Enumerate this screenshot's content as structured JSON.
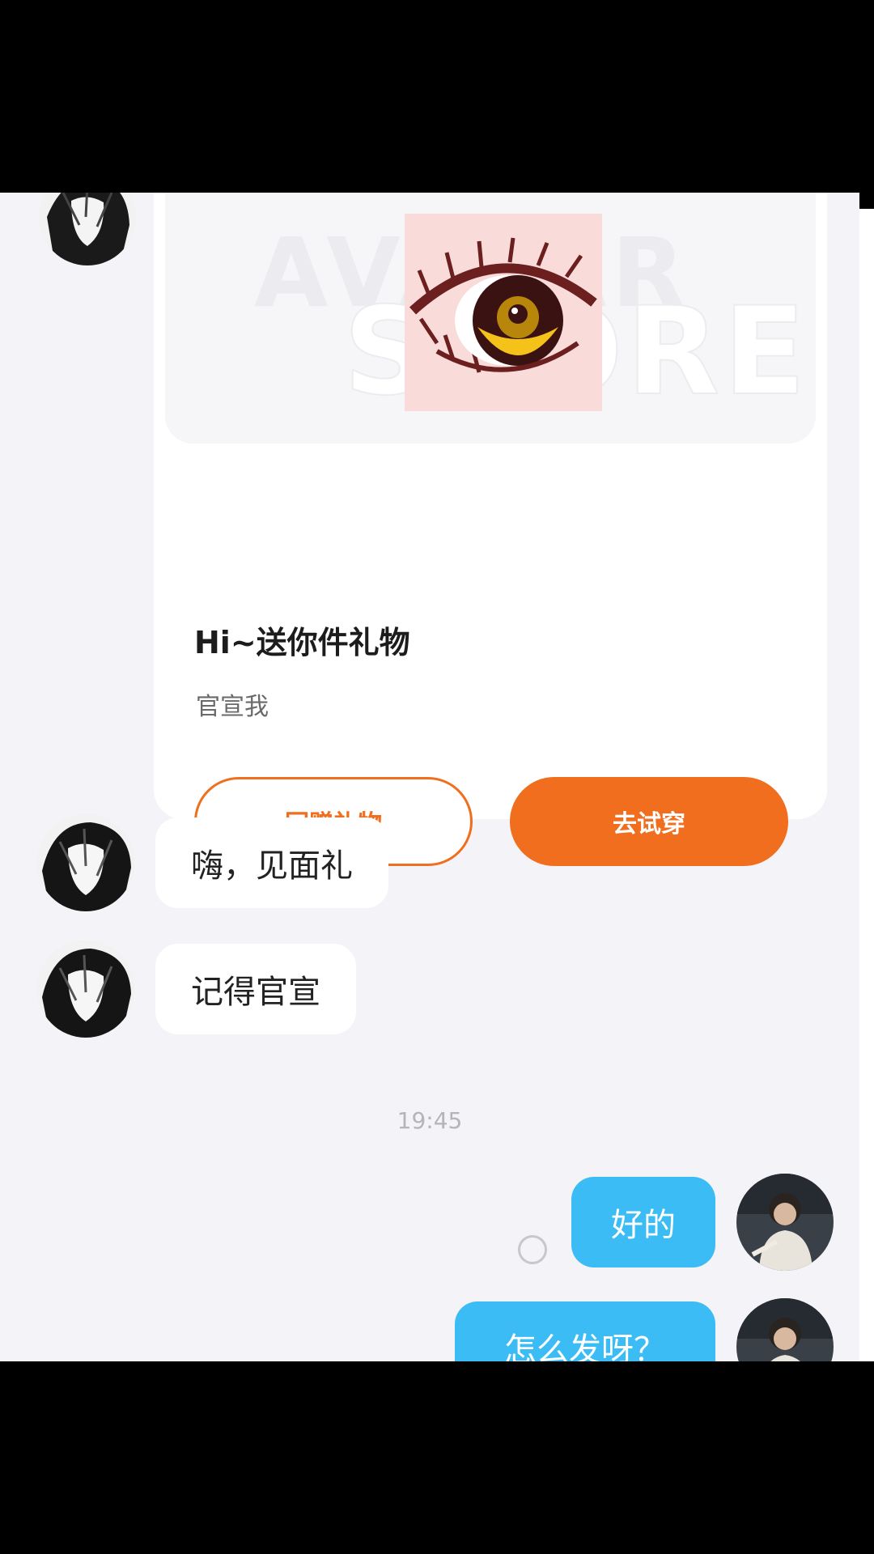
{
  "gift_card": {
    "watermark_line1": "AVATAR",
    "watermark_line2": "STORE",
    "title": "Hi~送你件礼物",
    "subtitle": "官宣我",
    "return_gift_label": "回赠礼物",
    "try_on_label": "去试穿"
  },
  "messages": [
    {
      "sender": "other",
      "text": "嗨，见面礼"
    },
    {
      "sender": "other",
      "text": "记得官宣"
    },
    {
      "sender": "me",
      "text": "好的"
    },
    {
      "sender": "me",
      "text": "怎么发呀？"
    }
  ],
  "timestamp": "19:45",
  "colors": {
    "accent_orange": "#f06e1e",
    "my_bubble_blue": "#3bbcf4",
    "chat_background": "#f3f3f8"
  }
}
